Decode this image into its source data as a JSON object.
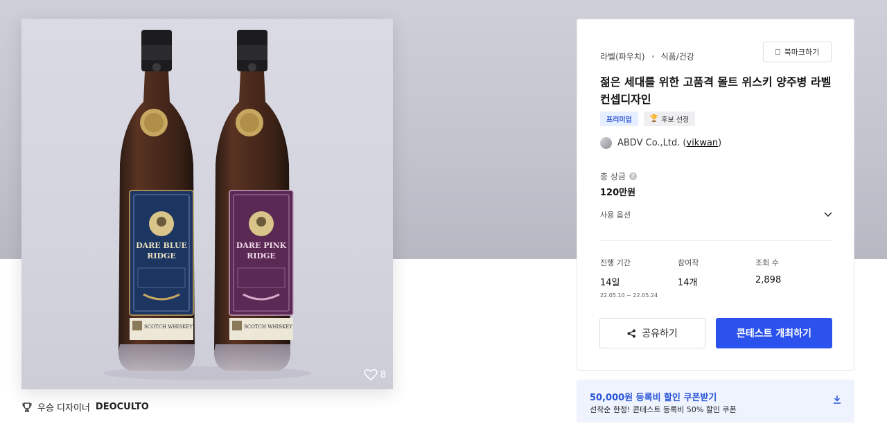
{
  "contest": {
    "category_primary": "라벨(파우치)",
    "category_secondary": "식품/건강",
    "bookmark_label": "북마크하기",
    "title": "젊은 세대를 위한 고품격 몰트 위스키 양주병 라벨 컨셉디자인",
    "badges": {
      "premium": "프리미엄",
      "nominee": "후보 선정"
    },
    "company": "ABDV Co.,Ltd.",
    "user_open": "(",
    "username": "vikwan",
    "user_close": ")",
    "prize_label": "총 상금",
    "prize_value": "120만원",
    "options_label": "사용 옵션"
  },
  "stats": {
    "period_label": "진행 기간",
    "period_value": "14일",
    "period_dates": "22.05.10 ~ 22.05.24",
    "entries_label": "참여작",
    "entries_value": "14개",
    "views_label": "조회 수",
    "views_value": "2,898"
  },
  "actions": {
    "share_label": "공유하기",
    "host_label": "콘테스트 개최하기"
  },
  "coupon": {
    "title": "50,000원 등록비 할인 쿠폰받기",
    "subtitle": "선착순 한정! 콘테스트 등록비 50% 할인 쿠폰"
  },
  "image": {
    "likes": "8",
    "bottle_left": {
      "line1": "DARE BLUE",
      "line2": "RIDGE",
      "footer": "SCOTCH WHISKEY",
      "color": "#1c3561"
    },
    "bottle_right": {
      "line1": "DARE PINK",
      "line2": "RIDGE",
      "footer": "SCOTCH WHISKEY",
      "color": "#5a2a55"
    }
  },
  "winner": {
    "label": "우승 디자이너",
    "name": "DEOCULTO"
  },
  "colors": {
    "accent": "#2b52ec",
    "coupon_bg": "#eef3fe",
    "coupon_text": "#2a55d8"
  }
}
